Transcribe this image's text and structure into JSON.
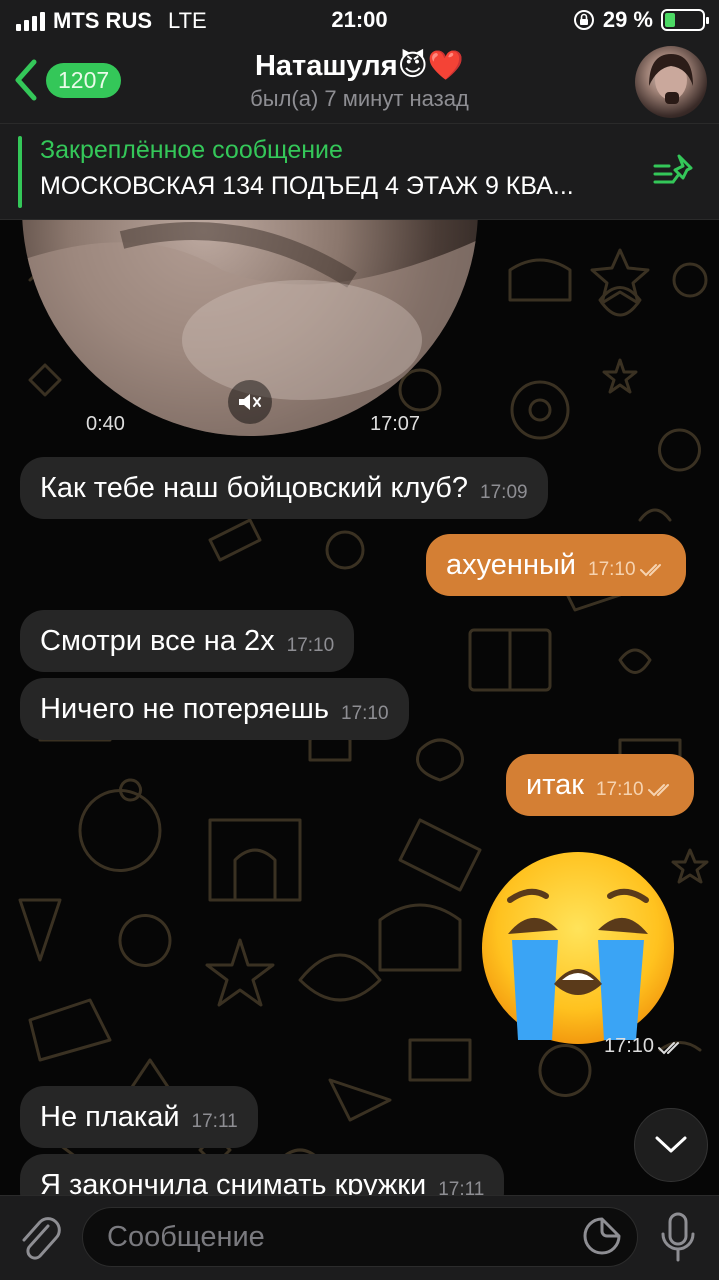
{
  "status_bar": {
    "carrier": "MTS RUS",
    "network": "LTE",
    "time": "21:00",
    "battery_percent": "29 %",
    "battery_level": 0.29
  },
  "header": {
    "back_count": "1207",
    "title": "Наташуля😈❤️",
    "subtitle": "был(а) 7 минут назад"
  },
  "pinned": {
    "title": "Закреплённое сообщение",
    "text": "МОСКОВСКАЯ 134 ПОДЪЕД 4 ЭТАЖ 9 КВА..."
  },
  "video_message": {
    "duration": "0:40",
    "time": "17:07"
  },
  "messages": [
    {
      "text": "Как тебе наш бойцовский клуб?",
      "time": "17:09",
      "direction": "in"
    },
    {
      "text": "ахуенный",
      "time": "17:10",
      "direction": "out"
    },
    {
      "text": "Смотри все на 2х",
      "time": "17:10",
      "direction": "in"
    },
    {
      "text": "Ничего не потеряешь",
      "time": "17:10",
      "direction": "in"
    },
    {
      "text": "итак",
      "time": "17:10",
      "direction": "out"
    },
    {
      "text": "Не плакай",
      "time": "17:11",
      "direction": "in"
    },
    {
      "text": "Я закончила снимать кружки",
      "time": "17:11",
      "direction": "in"
    }
  ],
  "sticker": {
    "emoji": "😭",
    "time": "17:10"
  },
  "input": {
    "placeholder": "Сообщение"
  },
  "colors": {
    "accent_green": "#34c759",
    "outgoing_bubble": "#d47f34",
    "incoming_bubble": "#262626"
  }
}
